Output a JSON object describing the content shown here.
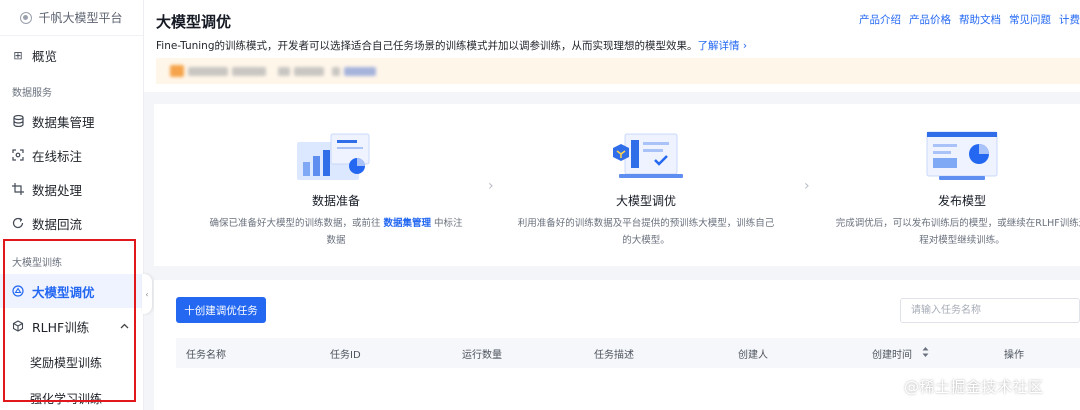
{
  "brand": {
    "name": "千帆大模型平台"
  },
  "sidebar": {
    "overview": "概览",
    "data_section": "数据服务",
    "data_items": [
      "数据集管理",
      "在线标注",
      "数据处理",
      "数据回流"
    ],
    "train_section": "大模型训练",
    "active_item": "大模型调优",
    "rlhf": {
      "label": "RLHF训练",
      "children": [
        "奖励模型训练",
        "强化学习训练"
      ]
    }
  },
  "header": {
    "title": "大模型调优",
    "links": [
      "产品介绍",
      "产品价格",
      "帮助文档",
      "常见问题",
      "计费"
    ],
    "description": "Fine-Tuning的训练模式，开发者可以选择适合自己任务场景的训练模式并加以调参训练，从而实现理想的模型效果。",
    "learn_more": "了解详情 ›"
  },
  "steps": [
    {
      "title": "数据准备",
      "desc_pre": "确保已准备好大模型的训练数据，或前往 ",
      "link": "数据集管理",
      "desc_post": " 中标注数据"
    },
    {
      "title": "大模型调优",
      "desc": "利用准备好的训练数据及平台提供的预训练大模型，训练自己的大模型。"
    },
    {
      "title": "发布模型",
      "desc": "完成调优后，可以发布训练后的模型，或继续在RLHF训练过程对模型继续训练。"
    }
  ],
  "tasks": {
    "create_button": "十创建调优任务",
    "search_placeholder": "请输入任务名称",
    "columns": [
      "任务名称",
      "任务ID",
      "运行数量",
      "任务描述",
      "创建人",
      "创建时间",
      "操作"
    ]
  },
  "watermark": "@稀土掘金技术社区",
  "colors": {
    "primary": "#2468f2",
    "highlight_box": "#e0181c",
    "notice_bg": "#fff6ea"
  }
}
